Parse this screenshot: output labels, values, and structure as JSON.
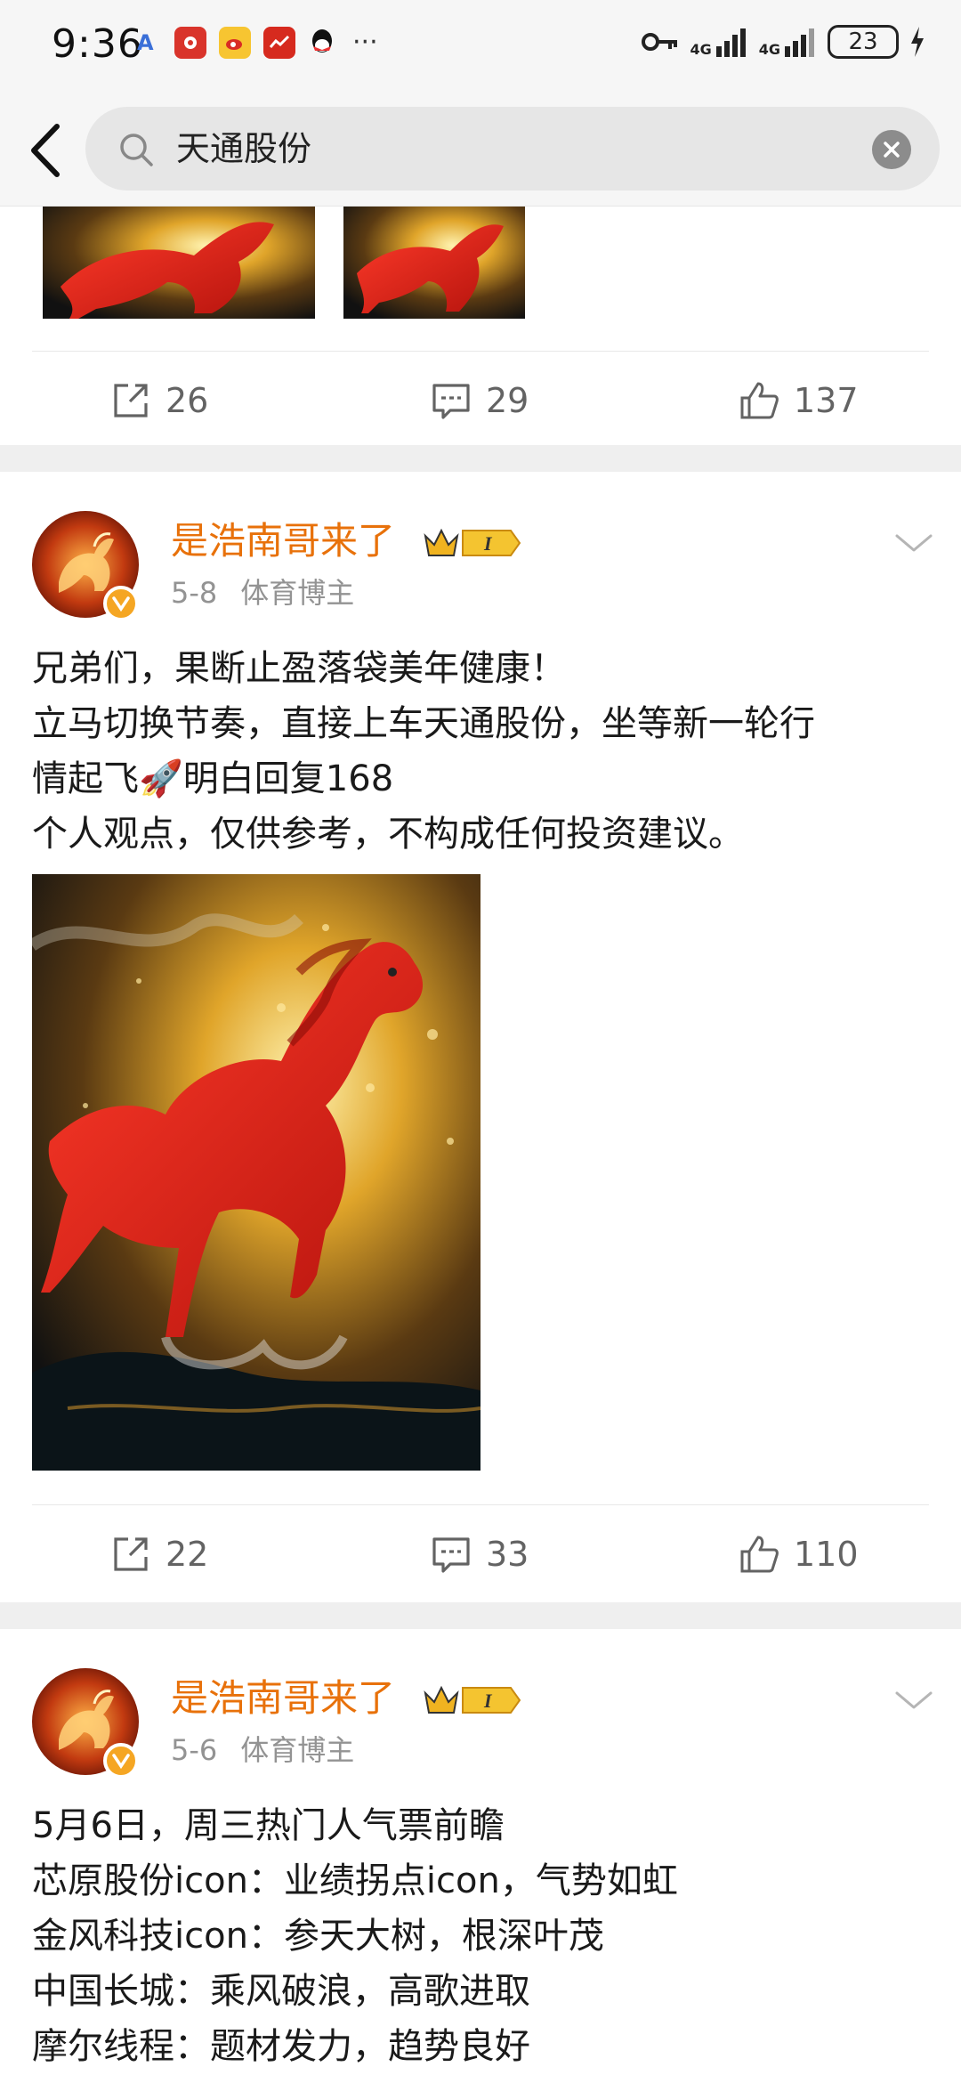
{
  "status_bar": {
    "time": "9:36",
    "network": [
      "4G",
      "4G"
    ],
    "battery": "23"
  },
  "search": {
    "query": "天通股份"
  },
  "posts": [
    {
      "actions": {
        "repost": "26",
        "comment": "29",
        "like": "137"
      }
    },
    {
      "author": "是浩南哥来了",
      "date": "5-8",
      "role": "体育博主",
      "text": [
        "兄弟们，果断止盈落袋美年健康！",
        "立马切换节奏，直接上车天通股份，坐等新一轮行",
        "情起飞🚀明白回复168",
        "个人观点，仅供参考，不构成任何投资建议。"
      ],
      "actions": {
        "repost": "22",
        "comment": "33",
        "like": "110"
      }
    },
    {
      "author": "是浩南哥来了",
      "date": "5-6",
      "role": "体育博主",
      "text": [
        "5月6日，周三热门人气票前瞻",
        "芯原股份icon：业绩拐点icon，气势如虹",
        "金风科技icon：参天大树，根深叶茂",
        "中国长城：乘风破浪，高歌进取",
        "摩尔线程：题材发力，趋势良好"
      ]
    }
  ],
  "icons": {
    "back": "back-arrow-icon",
    "search": "search-icon",
    "clear": "clear-icon",
    "repost": "repost-icon",
    "comment": "comment-icon",
    "like": "like-icon",
    "more": "chevron-down-icon"
  },
  "colors": {
    "author": "#e8710a",
    "meta": "#939393",
    "verified": "#f5a623",
    "separator": "#efefef"
  }
}
